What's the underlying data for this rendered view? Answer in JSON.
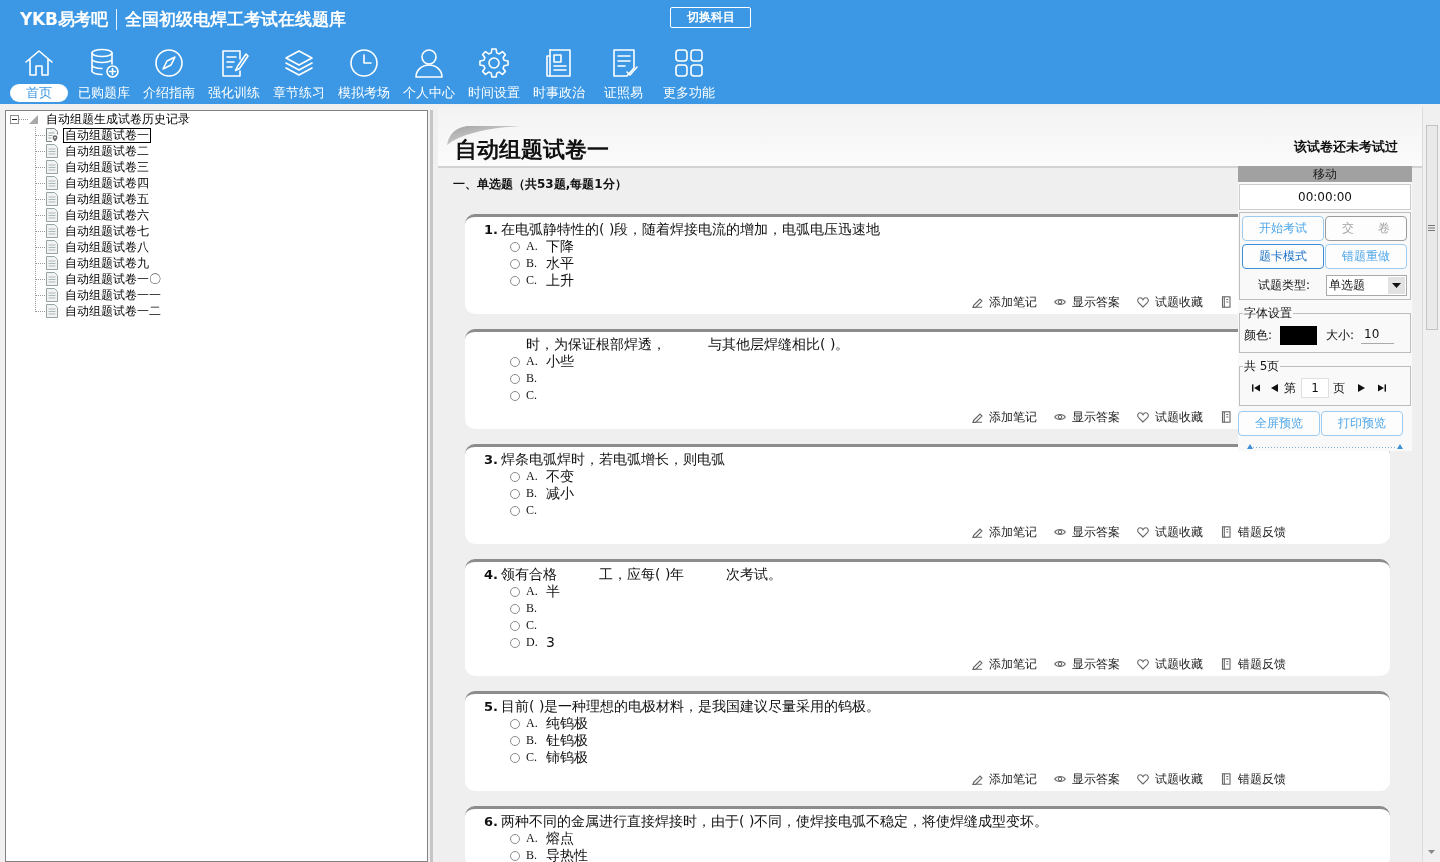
{
  "app": {
    "logo": "YKB易考吧",
    "title": "全国初级电焊工考试在线题库",
    "switch_button": "切换科目"
  },
  "nav": [
    {
      "kind": "home",
      "label": "首页",
      "selected": true
    },
    {
      "kind": "database",
      "label": "已购题库",
      "selected": false
    },
    {
      "kind": "compass",
      "label": "介绍指南",
      "selected": false
    },
    {
      "kind": "edit",
      "label": "强化训练",
      "selected": false
    },
    {
      "kind": "layers",
      "label": "章节练习",
      "selected": false
    },
    {
      "kind": "clock",
      "label": "模拟考场",
      "selected": false
    },
    {
      "kind": "user",
      "label": "个人中心",
      "selected": false
    },
    {
      "kind": "gear",
      "label": "时间设置",
      "selected": false
    },
    {
      "kind": "newspaper",
      "label": "时事政治",
      "selected": false
    },
    {
      "kind": "checklist",
      "label": "证照易",
      "selected": false
    },
    {
      "kind": "grid",
      "label": "更多功能",
      "selected": false
    }
  ],
  "tree": {
    "label": "自动组题生成试卷历史记录",
    "expanded": true,
    "children": [
      {
        "label": "自动组题试卷一",
        "selected": true
      },
      {
        "label": "自动组题试卷二",
        "selected": false
      },
      {
        "label": "自动组题试卷三",
        "selected": false
      },
      {
        "label": "自动组题试卷四",
        "selected": false
      },
      {
        "label": "自动组题试卷五",
        "selected": false
      },
      {
        "label": "自动组题试卷六",
        "selected": false
      },
      {
        "label": "自动组题试卷七",
        "selected": false
      },
      {
        "label": "自动组题试卷八",
        "selected": false
      },
      {
        "label": "自动组题试卷九",
        "selected": false
      },
      {
        "label": "自动组题试卷一〇",
        "selected": false
      },
      {
        "label": "自动组题试卷一一",
        "selected": false
      },
      {
        "label": "自动组题试卷一二",
        "selected": false
      }
    ]
  },
  "paper": {
    "title": "自动组题试卷一",
    "status": "该试卷还未考试过",
    "section": "一、单选题（共53题,每题1分）",
    "questions": [
      {
        "number": "1.",
        "parts": [
          "在电弧静特性的( )段，随着焊接电流的增加，电弧电压迅速地"
        ],
        "options": [
          {
            "label": "A.",
            "text": "下降",
            "selected": false
          },
          {
            "label": "B.",
            "text": "水平",
            "selected": false
          },
          {
            "label": "C.",
            "text": "上升",
            "selected": false
          }
        ],
        "actions": [
          {
            "kind": "note",
            "label": "添加笔记"
          },
          {
            "kind": "answer",
            "label": "显示答案"
          },
          {
            "kind": "favorite",
            "label": "试题收藏"
          },
          {
            "kind": "feedback"
          }
        ]
      },
      {
        "parts": [
          "时，为保证根部焊透，",
          "与其他层焊缝相比(  )。"
        ],
        "options": [
          {
            "label": "A.",
            "text": "小些",
            "selected": false
          },
          {
            "label": "B.",
            "selected": false
          },
          {
            "label": "C.",
            "selected": false
          }
        ],
        "actions": [
          {
            "kind": "note",
            "label": "添加笔记"
          },
          {
            "kind": "answer",
            "label": "显示答案"
          },
          {
            "kind": "favorite",
            "label": "试题收藏"
          },
          {
            "kind": "feedback"
          }
        ]
      },
      {
        "number": "3.",
        "parts": [
          "焊条电弧焊时，若电弧增长，则电弧"
        ],
        "options": [
          {
            "label": "A.",
            "text": "不变",
            "selected": false
          },
          {
            "label": "B.",
            "text": "减小",
            "selected": false
          },
          {
            "label": "C.",
            "selected": false
          }
        ],
        "actions": [
          {
            "kind": "note",
            "label": "添加笔记"
          },
          {
            "kind": "answer",
            "label": "显示答案"
          },
          {
            "kind": "favorite",
            "label": "试题收藏"
          },
          {
            "kind": "feedback",
            "label": "错题反馈"
          }
        ]
      },
      {
        "number": "4.",
        "parts": [
          "领有合格",
          "工，应每( )年",
          "次考试。"
        ],
        "options": [
          {
            "label": "A.",
            "text": "半",
            "selected": false
          },
          {
            "label": "B.",
            "selected": false
          },
          {
            "label": "C.",
            "selected": false
          },
          {
            "label": "D.",
            "text": "3",
            "selected": false
          }
        ],
        "actions": [
          {
            "kind": "note",
            "label": "添加笔记"
          },
          {
            "kind": "answer",
            "label": "显示答案"
          },
          {
            "kind": "favorite",
            "label": "试题收藏"
          },
          {
            "kind": "feedback",
            "label": "错题反馈"
          }
        ]
      },
      {
        "number": "5.",
        "parts": [
          "目前( )是一种理想的电极材料，是我国建议尽量采用的钨极。"
        ],
        "options": [
          {
            "label": "A.",
            "text": "纯钨极",
            "selected": false
          },
          {
            "label": "B.",
            "text": "钍钨极",
            "selected": false
          },
          {
            "label": "C.",
            "text": "铈钨极",
            "selected": false
          }
        ],
        "actions": [
          {
            "kind": "note",
            "label": "添加笔记"
          },
          {
            "kind": "answer",
            "label": "显示答案"
          },
          {
            "kind": "favorite",
            "label": "试题收藏"
          },
          {
            "kind": "feedback",
            "label": "错题反馈"
          }
        ]
      },
      {
        "number": "6.",
        "parts": [
          "两种不同的金属进行直接焊接时，由于( )不同，使焊接电弧不稳定，将使焊缝成型变坏。"
        ],
        "options": [
          {
            "label": "A.",
            "text": "熔点",
            "selected": false
          },
          {
            "label": "B.",
            "text": "导热性",
            "selected": false
          }
        ]
      }
    ]
  },
  "panel": {
    "handle": "移动",
    "timer": "00:00:00",
    "buttons": [
      {
        "label": "开始考试",
        "disabled": false,
        "selected": false
      },
      {
        "label": "交　　卷",
        "disabled": true,
        "selected": false
      },
      {
        "label": "题卡模式",
        "disabled": false,
        "selected": true
      },
      {
        "label": "错题重做",
        "disabled": false,
        "selected": false
      }
    ],
    "type_label": "试题类型:",
    "type_value": "单选题",
    "font": {
      "title": "字体设置",
      "color_label": "颜色:",
      "color": "#000000",
      "size_label": "大小:",
      "size": "10"
    },
    "pager": {
      "total": "共 5页",
      "before": "第",
      "page": "1",
      "after": "页"
    },
    "preview_buttons": [
      {
        "label": "全屏预览"
      },
      {
        "label": "打印预览"
      }
    ]
  }
}
